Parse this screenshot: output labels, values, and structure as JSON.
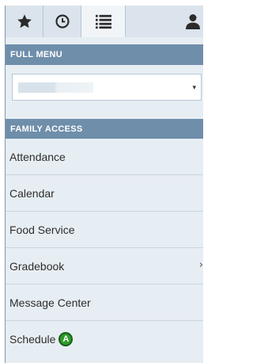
{
  "tabs": [
    {
      "icon": "star-icon",
      "active": false
    },
    {
      "icon": "clock-icon",
      "active": false
    },
    {
      "icon": "list-icon",
      "active": true
    },
    {
      "icon": "user-icon",
      "active": false
    }
  ],
  "full_menu": {
    "header": "FULL MENU",
    "caret": "▾"
  },
  "family_access": {
    "header": "FAMILY ACCESS",
    "items": [
      {
        "label": "Attendance"
      },
      {
        "label": "Calendar"
      },
      {
        "label": "Food Service"
      },
      {
        "label": "Gradebook",
        "chevron": "›"
      },
      {
        "label": "Message Center"
      },
      {
        "label": "Schedule",
        "badge": "A"
      }
    ]
  },
  "colors": {
    "header_bg": "#6f8eaa",
    "panel_bg": "#e7eef3",
    "badge_green": "#2e9c2a"
  }
}
